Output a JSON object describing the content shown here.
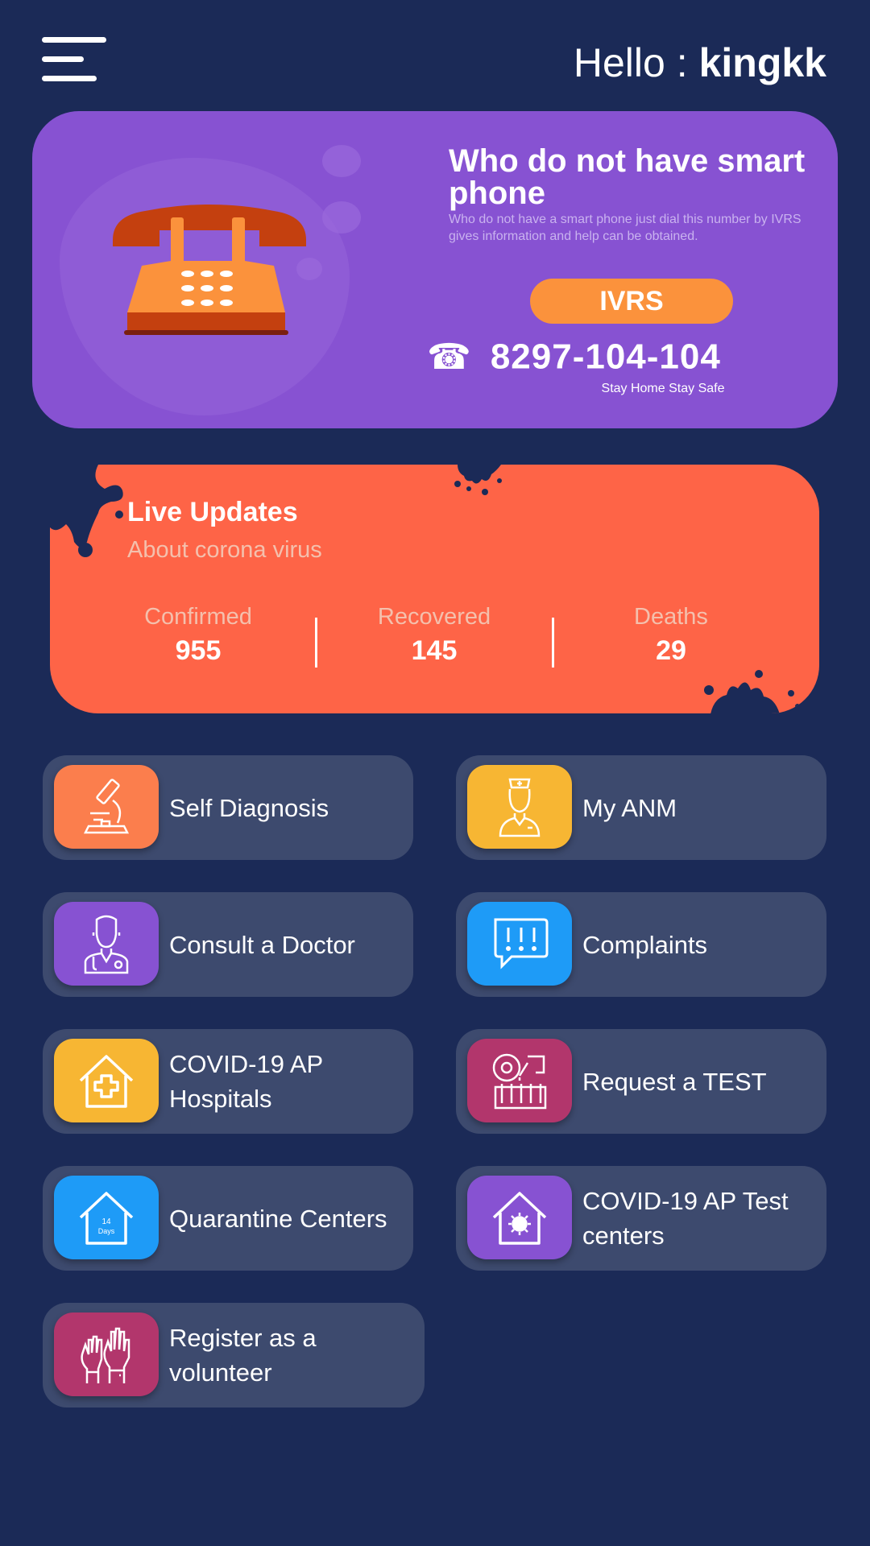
{
  "header": {
    "greeting": "Hello :",
    "username": "kingkk",
    "menu_icon": "hamburger-menu-icon"
  },
  "ivrs_banner": {
    "title": "Who do not have smart phone",
    "description": "Who do not have a smart phone just dial this number by  IVRS gives information and help can be obtained.",
    "button_label": "IVRS",
    "phone_glyph": "☎",
    "phone_number": "8297-104-104",
    "tagline": "Stay Home Stay Safe",
    "colors": {
      "background": "#8752d2",
      "button": "#fb923c"
    }
  },
  "live_updates": {
    "title": "Live Updates",
    "subtitle": "About corona virus",
    "stats": [
      {
        "label": "Confirmed",
        "value": "955"
      },
      {
        "label": "Recovered",
        "value": "145"
      },
      {
        "label": "Deaths",
        "value": "29"
      }
    ],
    "colors": {
      "background": "#fe6447"
    }
  },
  "services": [
    {
      "label": "Self Diagnosis",
      "icon": "microscope-icon",
      "color": "#fb7e4d"
    },
    {
      "label": "My ANM",
      "icon": "nurse-icon",
      "color": "#f7b633"
    },
    {
      "label": "Consult a Doctor",
      "icon": "doctor-icon",
      "color": "#8752d2"
    },
    {
      "label": "Complaints",
      "icon": "complaint-chat-icon",
      "color": "#1e9bf7"
    },
    {
      "label": "COVID-19 AP Hospitals",
      "icon": "hospital-house-icon",
      "color": "#f7b633"
    },
    {
      "label": "Request a TEST",
      "icon": "test-tubes-icon",
      "color": "#b2366c"
    },
    {
      "label": "Quarantine Centers",
      "icon": "quarantine-house-icon",
      "color": "#1e9bf7",
      "icon_text_1": "14",
      "icon_text_2": "Days"
    },
    {
      "label": "COVID-19 AP Test centers",
      "icon": "virus-house-icon",
      "color": "#8752d2"
    },
    {
      "label": "Register as a volunteer",
      "icon": "raised-hands-icon",
      "color": "#b2366c"
    }
  ],
  "colors": {
    "page_background": "#1b2a57",
    "tile_background": "#3d4a6e"
  }
}
